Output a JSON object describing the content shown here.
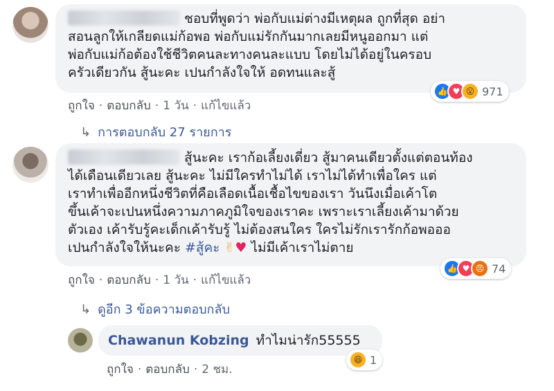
{
  "comment1": {
    "text": "ชอบที่พูดว่า พ่อกับแม่ต่างมีเหตุผล ถูกที่สุด อย่า\nสอนลูกให้เกลียดแม่ก้อพอ พ่อกับแม่รักกันมากเลยมีหนูออกมา แต่\nพ่อกับแม่ก้อต้องใช้ชีวิตคนละทางคนละแบบ โดยไม่ได้อยู่ในครอบ\nครัวเดียวกัน สู้นะคะ เปนกำลังใจให้ อดทนและสู้",
    "reaction_icons": [
      "like-icon",
      "love-icon",
      "wow-icon"
    ],
    "reaction_count": "971",
    "actions": {
      "like": "ถูกใจ",
      "reply": "ตอบกลับ",
      "time": "1 วัน",
      "edited": "แก้ไขแล้ว"
    }
  },
  "replies1": {
    "label": "การตอบกลับ 27 รายการ"
  },
  "comment2": {
    "line1": "สู้นะคะ เราก้อเลี้ยงเดี่ยว สู้มาคนเดียวตั้งแต่ตอนท้อง",
    "rest": "ได้เดือนเดียวเลย สู้นะคะ ไม่มีใครทำไม่ได้ เราไม่ได้ทำเพื่อใคร แต่\nเราทำเพื่ออีกหนึ่งชีวิตที่คือเลือดเนื้อเชื้อไขของเรา วันนึงเมื่อเค้าโต\nขึ้นเค้าจะเปนหนึ่งความภาคภูมิใจของเราคะ เพราะเราเลี้ยงเค้ามาด้วย\nตัวเอง เค้ารับรู้คะเด็กเค้ารับรู้ ไม่ต้องสนใคร ใครไม่รักเรารักก้อพอออ\nเปนกำลังใจให้นะคะ ",
    "hashtag": "#สู้คะ",
    "emoji_victory": "✌",
    "emoji_heart": "♥",
    "tail": "ไม่มีเค้าเราไม่ตาย",
    "reaction_icons": [
      "like-icon",
      "love-icon",
      "angry-icon"
    ],
    "reaction_count": "74",
    "actions": {
      "like": "ถูกใจ",
      "reply": "ตอบกลับ",
      "time": "1 วัน",
      "edited": "แก้ไขแล้ว"
    }
  },
  "replies2": {
    "label": "ดูอีก 3 ข้อความตอบกลับ"
  },
  "reply": {
    "author": "Chawanun Kobzing",
    "text": "ทำไมน่ารัก55555",
    "reaction_icons": [
      "haha-icon"
    ],
    "reaction_count": "1",
    "actions": {
      "like": "ถูกใจ",
      "reply": "ตอบกลับ",
      "time": "2 ชม."
    }
  }
}
